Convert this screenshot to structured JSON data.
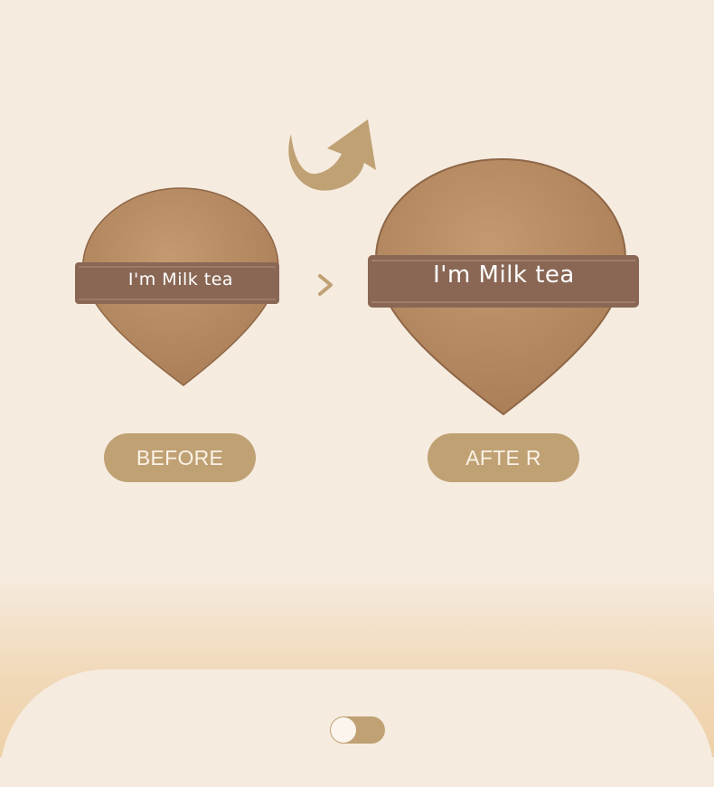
{
  "colors": {
    "background": "#f6ebdf",
    "accent": "#bfa174",
    "puff": "#b58a62",
    "strap": "#8a6755",
    "pill_text": "#fbf2e6"
  },
  "icons": {
    "curved_arrow": "curved-arrow-icon",
    "chevron": "chevron-right-icon"
  },
  "products": {
    "small": {
      "strap_text": "I'm Milk tea"
    },
    "large": {
      "strap_text": "I'm Milk tea"
    }
  },
  "labels": {
    "before": "BEFORE",
    "after": "AFTE R"
  },
  "toggle": {
    "state": "off"
  }
}
